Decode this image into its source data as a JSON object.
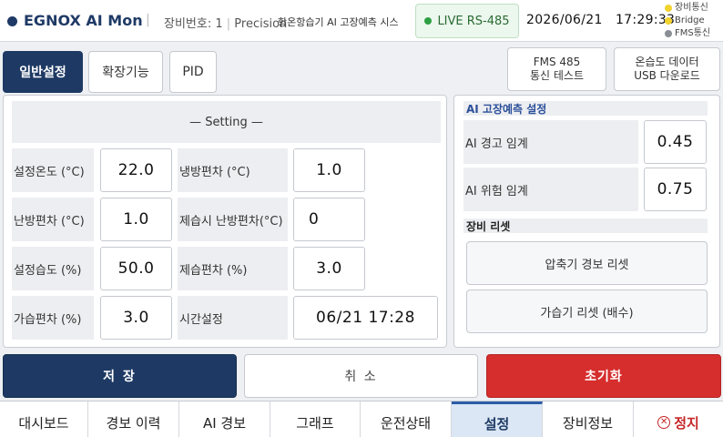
{
  "header": {
    "brand": "EGNOX AI Mon",
    "device_no": "장비번호: 1",
    "model": "Precision",
    "title": "항온항습기 AI 고장예측 시스",
    "live_label": "LIVE RS-485",
    "date": "2026/06/21",
    "time": "17:29:33",
    "status": [
      {
        "label": "장비통신",
        "color": "#f2d22e"
      },
      {
        "label": "Bridge",
        "color": "#f2d22e"
      },
      {
        "label": "FMS통신",
        "color": "#8a8f96"
      }
    ]
  },
  "tabs": [
    "일반설정",
    "확장기능",
    "PID"
  ],
  "tools": {
    "fms_test": [
      "FMS 485",
      "통신 테스트"
    ],
    "usb_download": [
      "온습도 데이터",
      "USB 다운로드"
    ]
  },
  "setting": {
    "header": "— Setting —",
    "rows": [
      {
        "l1": "설정온도 (°C)",
        "v1": "22.0",
        "l2": "냉방편차 (°C)",
        "v2": "1.0"
      },
      {
        "l1": "난방편차 (°C)",
        "v1": "1.0",
        "l2": "제습시 난방편차(°C)",
        "v2": "0"
      },
      {
        "l1": "설정습도 (%)",
        "v1": "50.0",
        "l2": "제습편차 (%)",
        "v2": "3.0"
      },
      {
        "l1": "가습편차 (%)",
        "v1": "3.0",
        "l2": "시간설정",
        "v2": "06/21 17:28"
      }
    ]
  },
  "ai": {
    "title": "AI 고장예측 설정",
    "warn_label": "AI 경고 임계",
    "warn_value": "0.45",
    "danger_label": "AI 위험 임계",
    "danger_value": "0.75"
  },
  "device_reset": {
    "title": "장비 리셋",
    "compressor": "압축기 경보 리셋",
    "humidifier": "가습기 리셋 (배수)"
  },
  "actions": {
    "save": "저 장",
    "cancel": "취 소",
    "reset": "초기화"
  },
  "nav": [
    "대시보드",
    "경보 이력",
    "AI 경보",
    "그래프",
    "운전상태",
    "설정",
    "장비정보",
    "정지"
  ],
  "colors": {
    "primary": "#1e3a64",
    "danger": "#d62d2d",
    "live": "#2ea043"
  }
}
